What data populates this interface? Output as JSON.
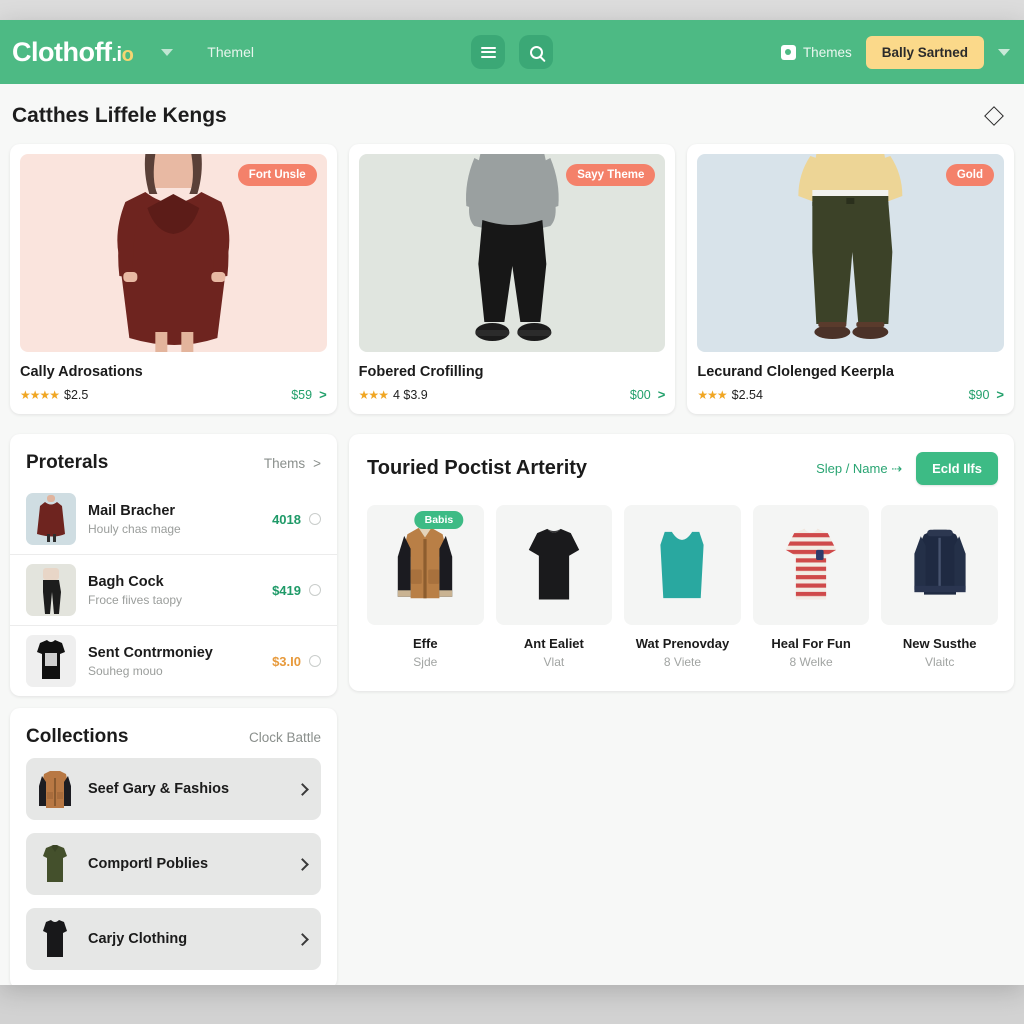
{
  "header": {
    "brand": "Clothoff",
    "brand_suffix": ".io",
    "nav_item": "Themel",
    "menu_icon": "hamburger-icon",
    "search_icon": "search-icon",
    "themes_label": "Themes",
    "cta_label": "Bally Sartned",
    "accent_green": "#4dba84",
    "cta_bg": "#fbd98a"
  },
  "page": {
    "title": "Catthes Liffele Kengs",
    "corner_icon": "diamond-icon"
  },
  "cards": [
    {
      "badge": "Fort Unsle",
      "title": "Cally Adrosations",
      "stars": "★★★★",
      "rating": "$2.5",
      "price": "$59",
      "bg": "#fae4dd"
    },
    {
      "badge": "Sayy Theme",
      "title": "Fobered Crofilling",
      "stars": "★★★",
      "rating": "4 $3.9",
      "price": "$00",
      "bg": "#e0e5df"
    },
    {
      "badge": "Gold",
      "title": "Lecurand Clolenged Keerpla",
      "stars": "★★★",
      "rating": "$2.54",
      "price": "$90",
      "bg": "#d8e3ea"
    }
  ],
  "proterals": {
    "title": "Proterals",
    "link": "Thems",
    "items": [
      {
        "name": "Mail Bracher",
        "sub": "Houly chas mage",
        "price": "4018",
        "warn": false
      },
      {
        "name": "Bagh Cock",
        "sub": "Froce fiives taopy",
        "price": "$419",
        "warn": false
      },
      {
        "name": "Sent Contrmoniey",
        "sub": "Souheg mouo",
        "price": "$3.I0",
        "warn": true
      }
    ]
  },
  "collections": {
    "title": "Collections",
    "link": "Clock Battle",
    "items": [
      {
        "label": "Seef Gary & Fashios"
      },
      {
        "label": "Comportl Poblies"
      },
      {
        "label": "Carjy Clothing"
      }
    ]
  },
  "activity": {
    "title": "Touried Poctist Arterity",
    "sort_label": "Slep / Name",
    "button": "Ecld Ilfs",
    "items": [
      {
        "badge": "Babis",
        "name": "Effe",
        "sub": "Sjde"
      },
      {
        "badge": "",
        "name": "Ant Ealiet",
        "sub": "Vlat"
      },
      {
        "badge": "",
        "name": "Wat Prenovday",
        "sub": "8 Viete"
      },
      {
        "badge": "",
        "name": "Heal For Fun",
        "sub": "8 Welke"
      },
      {
        "badge": "",
        "name": "New Susthe",
        "sub": "Vlaitc"
      }
    ]
  }
}
